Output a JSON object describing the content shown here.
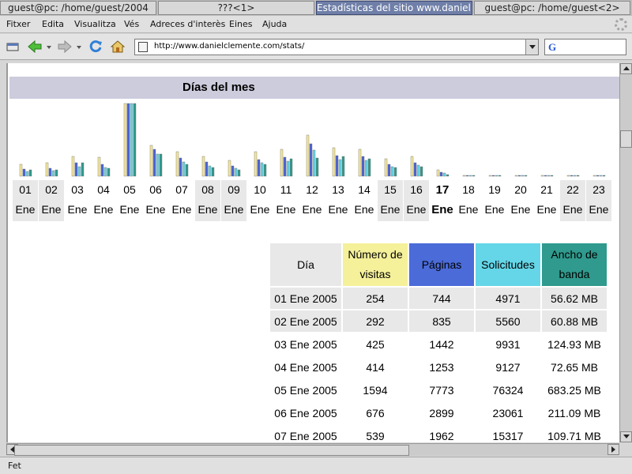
{
  "taskbar": [
    {
      "label": "guest@pc: /home/guest/2004",
      "active": false
    },
    {
      "label": "???<1>",
      "active": false
    },
    {
      "label": "Estadísticas del sitio www.daniel...",
      "active": true
    },
    {
      "label": "guest@pc: /home/guest<2>",
      "active": false
    }
  ],
  "menu": [
    "Fitxer",
    "Edita",
    "Visualitza",
    "Vés",
    "Adreces d'interès",
    "Eines",
    "Ajuda"
  ],
  "url": "http://www.danielclemente.com/stats/",
  "section_title": "Días del mes",
  "colors": {
    "visits": "#f5e89a",
    "pages": "#4a63d8",
    "hits": "#64d6e8",
    "bandwidth": "#2f9a8d"
  },
  "days": [
    {
      "n": "01",
      "m": "Ene",
      "weekend": true
    },
    {
      "n": "02",
      "m": "Ene",
      "weekend": true
    },
    {
      "n": "03",
      "m": "Ene",
      "weekend": false
    },
    {
      "n": "04",
      "m": "Ene",
      "weekend": false
    },
    {
      "n": "05",
      "m": "Ene",
      "weekend": false
    },
    {
      "n": "06",
      "m": "Ene",
      "weekend": false
    },
    {
      "n": "07",
      "m": "Ene",
      "weekend": false
    },
    {
      "n": "08",
      "m": "Ene",
      "weekend": true
    },
    {
      "n": "09",
      "m": "Ene",
      "weekend": true
    },
    {
      "n": "10",
      "m": "Ene",
      "weekend": false
    },
    {
      "n": "11",
      "m": "Ene",
      "weekend": false
    },
    {
      "n": "12",
      "m": "Ene",
      "weekend": false
    },
    {
      "n": "13",
      "m": "Ene",
      "weekend": false
    },
    {
      "n": "14",
      "m": "Ene",
      "weekend": false
    },
    {
      "n": "15",
      "m": "Ene",
      "weekend": true
    },
    {
      "n": "16",
      "m": "Ene",
      "weekend": true
    },
    {
      "n": "17",
      "m": "Ene",
      "weekend": false,
      "today": true
    },
    {
      "n": "18",
      "m": "Ene",
      "weekend": false
    },
    {
      "n": "19",
      "m": "Ene",
      "weekend": false
    },
    {
      "n": "20",
      "m": "Ene",
      "weekend": false
    },
    {
      "n": "21",
      "m": "Ene",
      "weekend": false
    },
    {
      "n": "22",
      "m": "Ene",
      "weekend": true
    },
    {
      "n": "23",
      "m": "Ene",
      "weekend": true
    }
  ],
  "chart_data": {
    "type": "bar",
    "categories": [
      "01",
      "02",
      "03",
      "04",
      "05",
      "06",
      "07",
      "08",
      "09",
      "10",
      "11",
      "12",
      "13",
      "14",
      "15",
      "16",
      "17",
      "18",
      "19",
      "20",
      "21",
      "22",
      "23"
    ],
    "series": [
      {
        "values": [
          254,
          292,
          425,
          414,
          1594,
          676,
          539,
          433,
          341,
          530,
          584,
          893,
          618,
          597,
          388,
          427,
          140,
          0,
          0,
          0,
          0,
          0,
          0
        ]
      },
      {
        "values": [
          744,
          835,
          1442,
          1253,
          7773,
          2899,
          1962,
          1490,
          1082,
          1760,
          2010,
          3480,
          2230,
          2100,
          1300,
          1420,
          400,
          0,
          0,
          0,
          0,
          0,
          0
        ]
      },
      {
        "values": [
          4971,
          5560,
          9931,
          9127,
          76324,
          23061,
          15317,
          10800,
          8300,
          14000,
          15800,
          27500,
          17800,
          16900,
          10100,
          11200,
          3100,
          0,
          0,
          0,
          0,
          0,
          0
        ]
      },
      {
        "values": [
          56.62,
          60.88,
          124.93,
          72.65,
          683.25,
          211.09,
          109.71,
          78,
          62,
          112,
          160,
          172,
          182,
          166,
          82,
          92,
          18,
          0,
          0,
          0,
          0,
          0,
          0
        ]
      }
    ]
  },
  "table": {
    "headers": [
      "Día",
      "Número de visitas",
      "Páginas",
      "Solicitudes",
      "Ancho de banda"
    ],
    "rows": [
      {
        "day": "01 Ene 2005",
        "visits": "254",
        "pages": "744",
        "hits": "4971",
        "bw": "56.62 MB",
        "weekend": true
      },
      {
        "day": "02 Ene 2005",
        "visits": "292",
        "pages": "835",
        "hits": "5560",
        "bw": "60.88 MB",
        "weekend": true
      },
      {
        "day": "03 Ene 2005",
        "visits": "425",
        "pages": "1442",
        "hits": "9931",
        "bw": "124.93 MB",
        "weekend": false
      },
      {
        "day": "04 Ene 2005",
        "visits": "414",
        "pages": "1253",
        "hits": "9127",
        "bw": "72.65 MB",
        "weekend": false
      },
      {
        "day": "05 Ene 2005",
        "visits": "1594",
        "pages": "7773",
        "hits": "76324",
        "bw": "683.25 MB",
        "weekend": false
      },
      {
        "day": "06 Ene 2005",
        "visits": "676",
        "pages": "2899",
        "hits": "23061",
        "bw": "211.09 MB",
        "weekend": false
      },
      {
        "day": "07 Ene 2005",
        "visits": "539",
        "pages": "1962",
        "hits": "15317",
        "bw": "109.71 MB",
        "weekend": false
      }
    ]
  },
  "status": "Fet",
  "icons": {
    "new_window": "new-window-icon",
    "back": "back-arrow-icon",
    "forward": "forward-arrow-icon",
    "reload": "reload-icon",
    "home": "home-icon",
    "site": "site-icon",
    "search_engine": "google-icon"
  }
}
